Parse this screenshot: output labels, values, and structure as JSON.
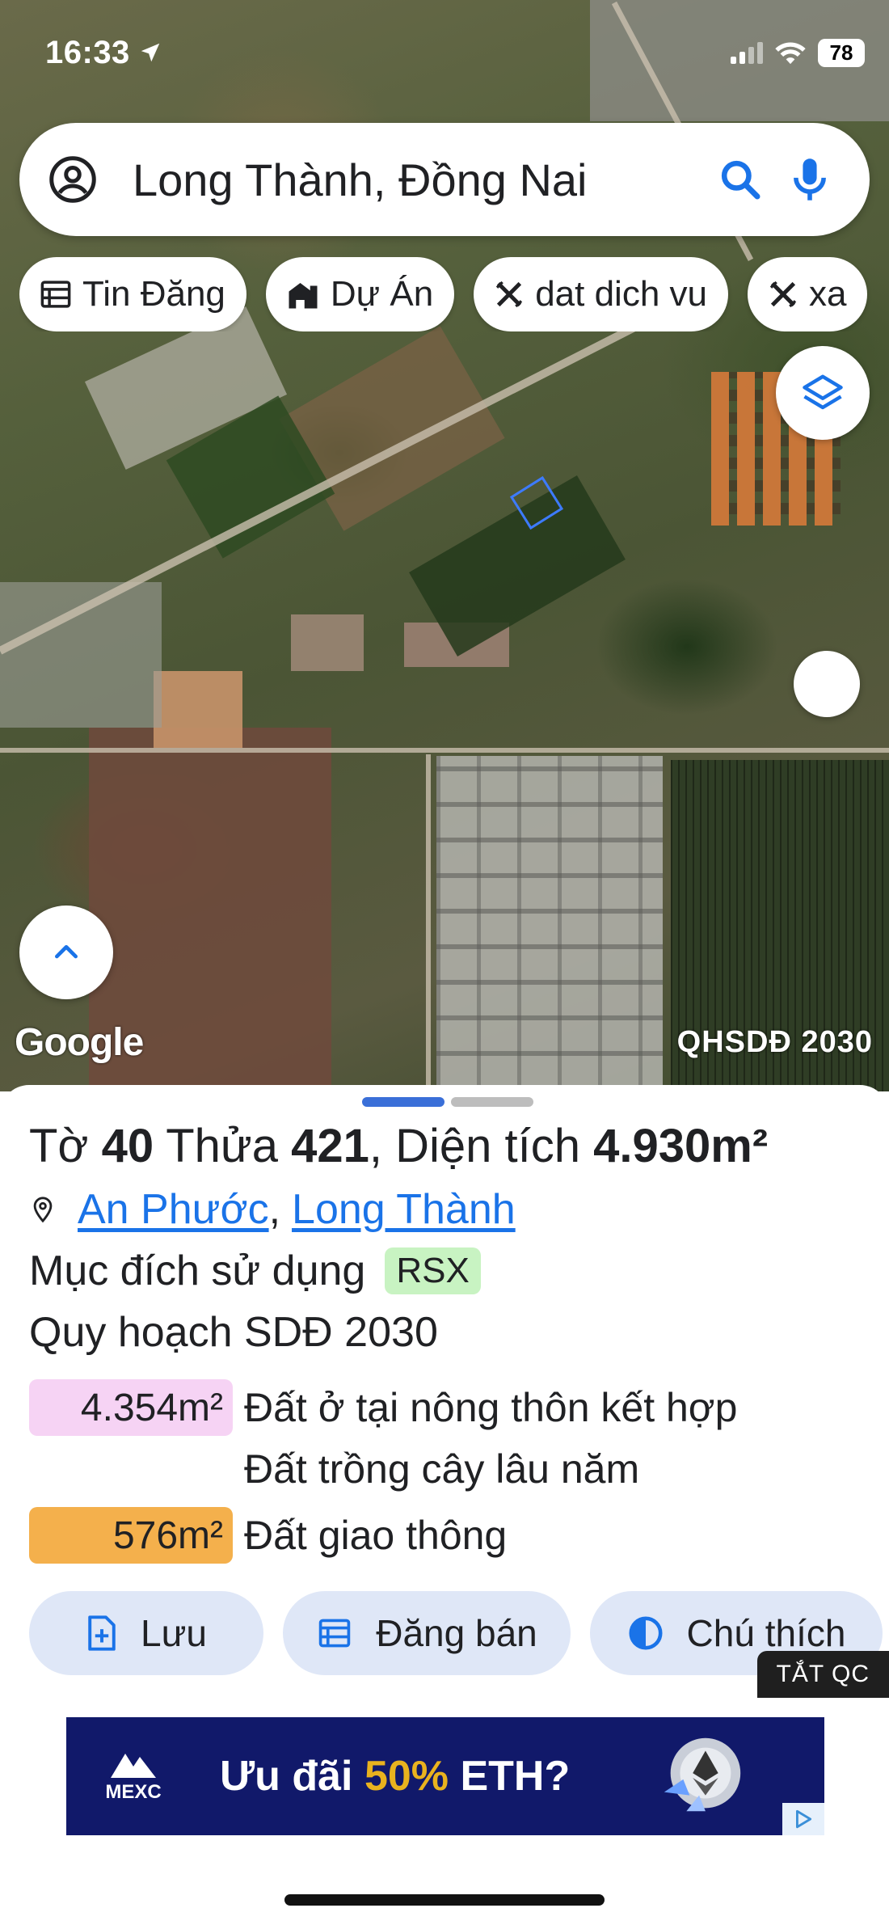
{
  "status_bar": {
    "time": "16:33",
    "battery": "78"
  },
  "search": {
    "query": "Long Thành, Đồng Nai"
  },
  "chips": [
    {
      "label": "Tin Đăng",
      "icon": "listing-icon"
    },
    {
      "label": "Dự Án",
      "icon": "building-icon"
    },
    {
      "label": "dat dich vu",
      "icon": "tool-icon"
    },
    {
      "label": "xa",
      "icon": "tool-icon"
    }
  ],
  "map": {
    "attribution": "Google",
    "overlay_label": "QHSDĐ 2030",
    "parcel_color": "#3d7bff"
  },
  "sheet": {
    "handle_colors": [
      "#3a6fd8",
      "#bdbdbd"
    ],
    "title": {
      "sheet_label": "Tờ",
      "sheet_no": "40",
      "plot_label": "Thửa",
      "plot_no": "421",
      "area_label": ", Diện tích",
      "area_value": "4.930m²"
    },
    "location": {
      "ward": "An Phước",
      "separator": ",",
      "district": "Long Thành"
    },
    "purpose": {
      "label": "Mục đích sử dụng",
      "code": "RSX"
    },
    "planning_label": "Quy hoạch SDĐ 2030",
    "zones": [
      {
        "area": "4.354m²",
        "color": "#f6d3f4",
        "lines": [
          "Đất ở tại nông thôn kết hợp",
          "Đất trồng cây lâu năm"
        ]
      },
      {
        "area": "576m²",
        "color": "#f4b04c",
        "lines": [
          "Đất giao thông"
        ]
      }
    ],
    "actions": [
      {
        "label": "Lưu",
        "icon": "bookmark-add-icon"
      },
      {
        "label": "Đăng bán",
        "icon": "post-listing-icon"
      },
      {
        "label": "Chú thích",
        "icon": "legend-contrast-icon"
      }
    ],
    "ad_close": "TẮT QC",
    "ad": {
      "brand": "MEXC",
      "text_prefix": "Ưu đãi ",
      "text_highlight": "50%",
      "text_suffix": " ETH?"
    }
  }
}
